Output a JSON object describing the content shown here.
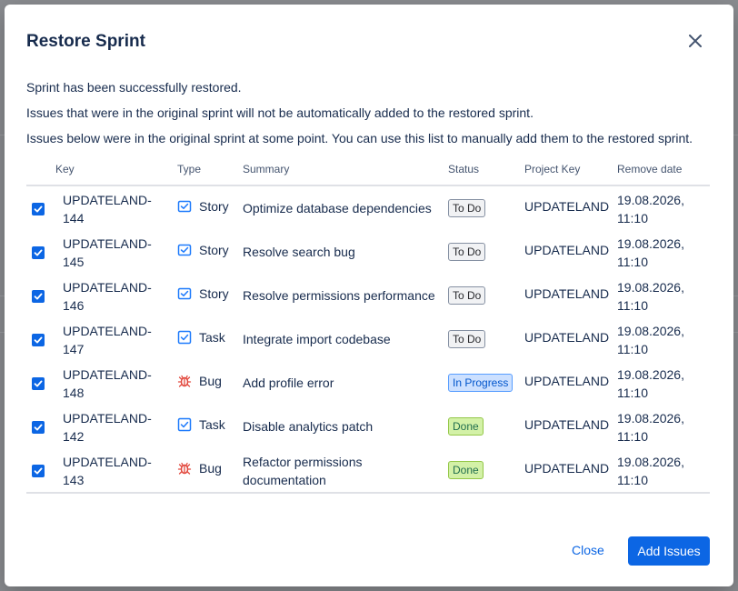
{
  "dialog": {
    "title": "Restore Sprint",
    "messages": [
      "Sprint has been successfully restored.",
      "Issues that were in the original sprint will not be automatically added to the restored sprint.",
      "Issues below were in the original sprint at some point. You can use this list to manually add them to the restored sprint."
    ],
    "columns": {
      "key": "Key",
      "type": "Type",
      "summary": "Summary",
      "status": "Status",
      "project_key": "Project Key",
      "remove_date": "Remove date"
    },
    "rows": [
      {
        "checked": true,
        "key": "UPDATELAND-144",
        "key_line1": "UPDATELAND-",
        "key_line2": "144",
        "type": "Story",
        "type_icon": "story-icon",
        "summary_line1": "Optimize database dependencies",
        "summary_line2": "",
        "status": "To Do",
        "project": "UPDATELAND",
        "date_line1": "19.08.2026,",
        "date_line2": "11:10"
      },
      {
        "checked": true,
        "key": "UPDATELAND-145",
        "key_line1": "UPDATELAND-",
        "key_line2": "145",
        "type": "Story",
        "type_icon": "story-icon",
        "summary_line1": "Resolve search bug",
        "summary_line2": "",
        "status": "To Do",
        "project": "UPDATELAND",
        "date_line1": "19.08.2026,",
        "date_line2": "11:10"
      },
      {
        "checked": true,
        "key": "UPDATELAND-146",
        "key_line1": "UPDATELAND-",
        "key_line2": "146",
        "type": "Story",
        "type_icon": "story-icon",
        "summary_line1": "Resolve permissions performance",
        "summary_line2": "",
        "status": "To Do",
        "project": "UPDATELAND",
        "date_line1": "19.08.2026,",
        "date_line2": "11:10"
      },
      {
        "checked": true,
        "key": "UPDATELAND-147",
        "key_line1": "UPDATELAND-",
        "key_line2": "147",
        "type": "Task",
        "type_icon": "task-icon",
        "summary_line1": "Integrate import codebase",
        "summary_line2": "",
        "status": "To Do",
        "project": "UPDATELAND",
        "date_line1": "19.08.2026,",
        "date_line2": "11:10"
      },
      {
        "checked": true,
        "key": "UPDATELAND-148",
        "key_line1": "UPDATELAND-",
        "key_line2": "148",
        "type": "Bug",
        "type_icon": "bug-icon",
        "summary_line1": "Add profile error",
        "summary_line2": "",
        "status": "In Progress",
        "project": "UPDATELAND",
        "date_line1": "19.08.2026,",
        "date_line2": "11:10"
      },
      {
        "checked": true,
        "key": "UPDATELAND-142",
        "key_line1": "UPDATELAND-",
        "key_line2": "142",
        "type": "Task",
        "type_icon": "task-icon",
        "summary_line1": "Disable analytics patch",
        "summary_line2": "",
        "status": "Done",
        "project": "UPDATELAND",
        "date_line1": "19.08.2026,",
        "date_line2": "11:10"
      },
      {
        "checked": true,
        "key": "UPDATELAND-143",
        "key_line1": "UPDATELAND-",
        "key_line2": "143",
        "type": "Bug",
        "type_icon": "bug-icon",
        "summary_line1": "Refactor permissions",
        "summary_line2": "documentation",
        "status": "Done",
        "project": "UPDATELAND",
        "date_line1": "19.08.2026,",
        "date_line2": "11:10"
      }
    ],
    "close_label": "Close",
    "add_label": "Add Issues"
  },
  "colors": {
    "accent": "#0c66e4",
    "bug": "#e2483d",
    "story_task": "#1d7afc"
  }
}
